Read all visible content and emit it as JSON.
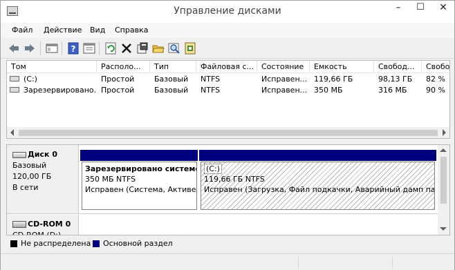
{
  "window": {
    "title": "Управление дисками",
    "controls": {
      "minimize": "–",
      "maximize": "☐",
      "close": "✕"
    }
  },
  "menu": [
    "Файл",
    "Действие",
    "Вид",
    "Справка"
  ],
  "toolbar": [
    "back-arrow-icon",
    "forward-arrow-icon",
    "console-icon",
    "help-icon",
    "properties-icon",
    "refresh-icon",
    "delete-icon",
    "settings-icon",
    "open-folder-icon",
    "search-icon",
    "export-icon"
  ],
  "volumes": {
    "columns": [
      "Том",
      "Располо...",
      "Тип",
      "Файловая с...",
      "Состояние",
      "Емкость",
      "Свобод...",
      "Свобо..."
    ],
    "rows": [
      [
        "(C:)",
        "Простой",
        "Базовый",
        "NTFS",
        "Исправен...",
        "119,66 ГБ",
        "98,13 ГБ",
        "82 %"
      ],
      [
        "Зарезервировано...",
        "Простой",
        "Базовый",
        "NTFS",
        "Исправен...",
        "350 МБ",
        "316 МБ",
        "90 %"
      ]
    ]
  },
  "disks": [
    {
      "name": "Диск 0",
      "type": "Базовый",
      "size": "120,00 ГБ",
      "status": "В сети",
      "partitions": [
        {
          "title": "Зарезервировано системой",
          "size": "350 МБ NTFS",
          "state": "Исправен (Система, Активен, Основной раздел)"
        },
        {
          "title": "(C:)",
          "size": "119,66 ГБ NTFS",
          "state": "Исправен (Загрузка, Файл подкачки, Аварийный дамп памяти, Основной раздел)"
        }
      ]
    },
    {
      "name": "CD-ROM 0",
      "drive": "CD-ROM (D:)"
    }
  ],
  "legend": [
    {
      "label": "Не распределена",
      "color": "#000000"
    },
    {
      "label": "Основной раздел",
      "color": "#00007f"
    }
  ]
}
